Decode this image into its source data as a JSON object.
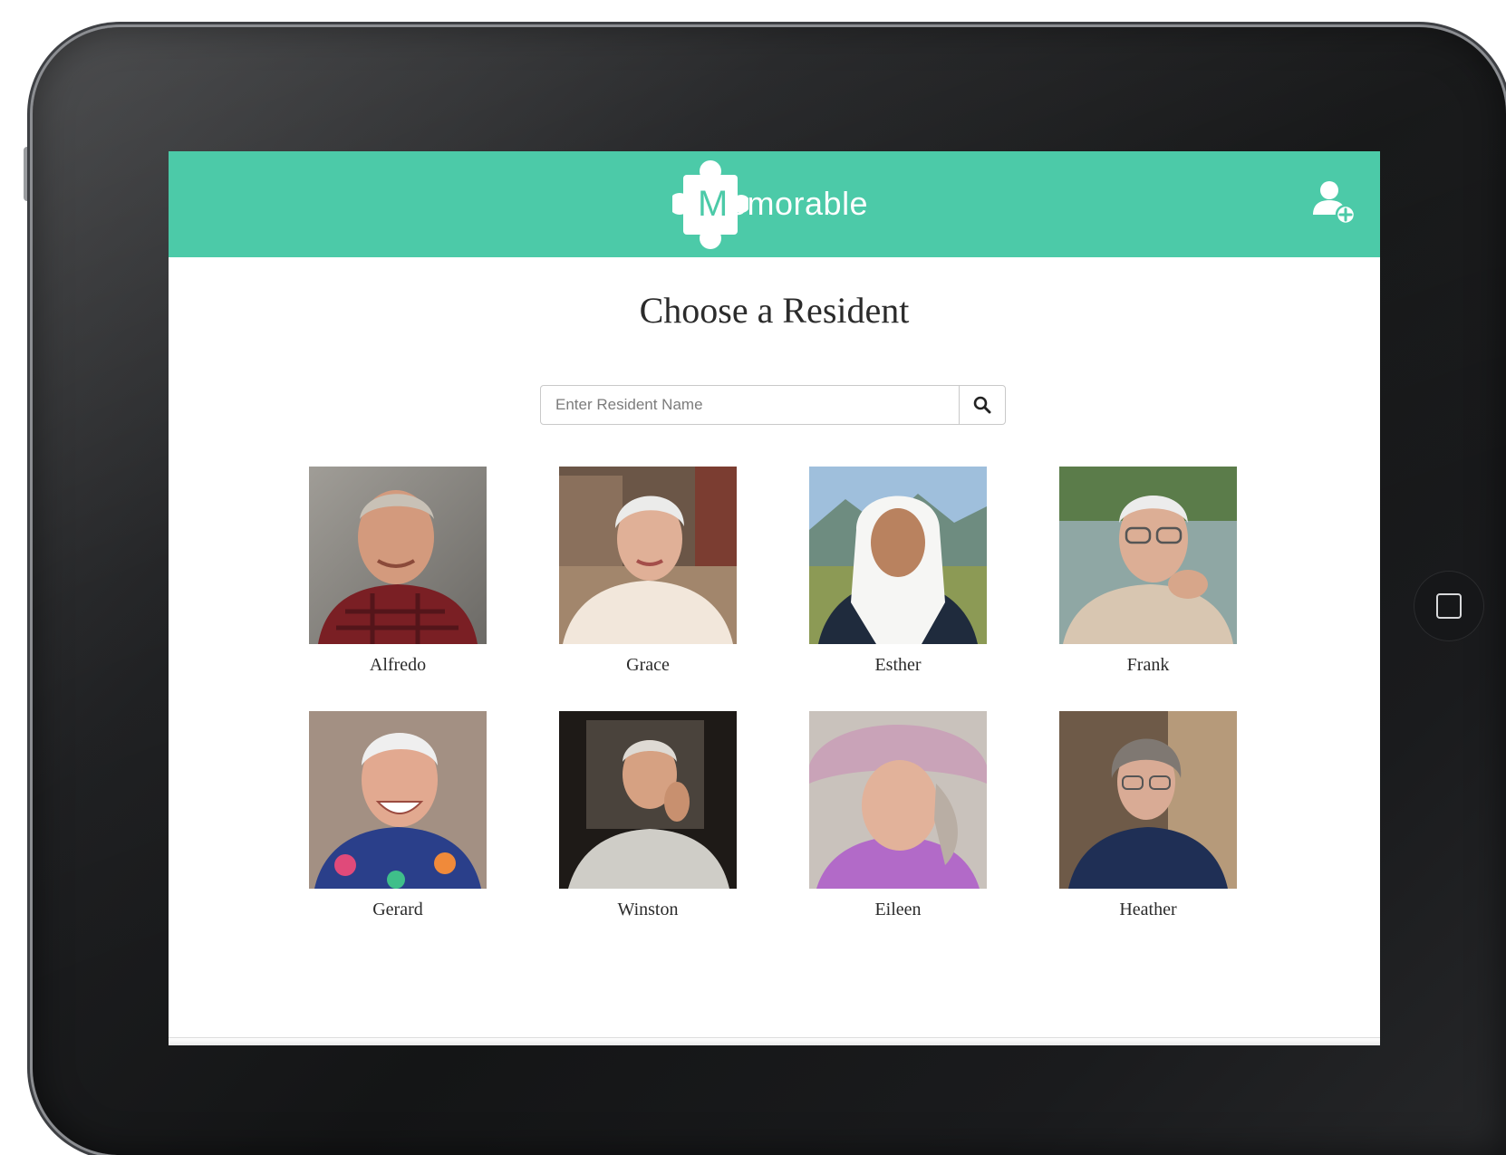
{
  "app": {
    "logo_letter": "M",
    "logo_rest": "emorable",
    "brand_color": "#4ccaa8"
  },
  "header": {
    "add_user_icon": "add-user-icon"
  },
  "main": {
    "title": "Choose a Resident",
    "search": {
      "placeholder": "Enter Resident Name",
      "value": "",
      "icon": "search-icon"
    },
    "residents": [
      {
        "name": "Alfredo"
      },
      {
        "name": "Grace"
      },
      {
        "name": "Esther"
      },
      {
        "name": "Frank"
      },
      {
        "name": "Gerard"
      },
      {
        "name": "Winston"
      },
      {
        "name": "Eileen"
      },
      {
        "name": "Heather"
      }
    ]
  }
}
